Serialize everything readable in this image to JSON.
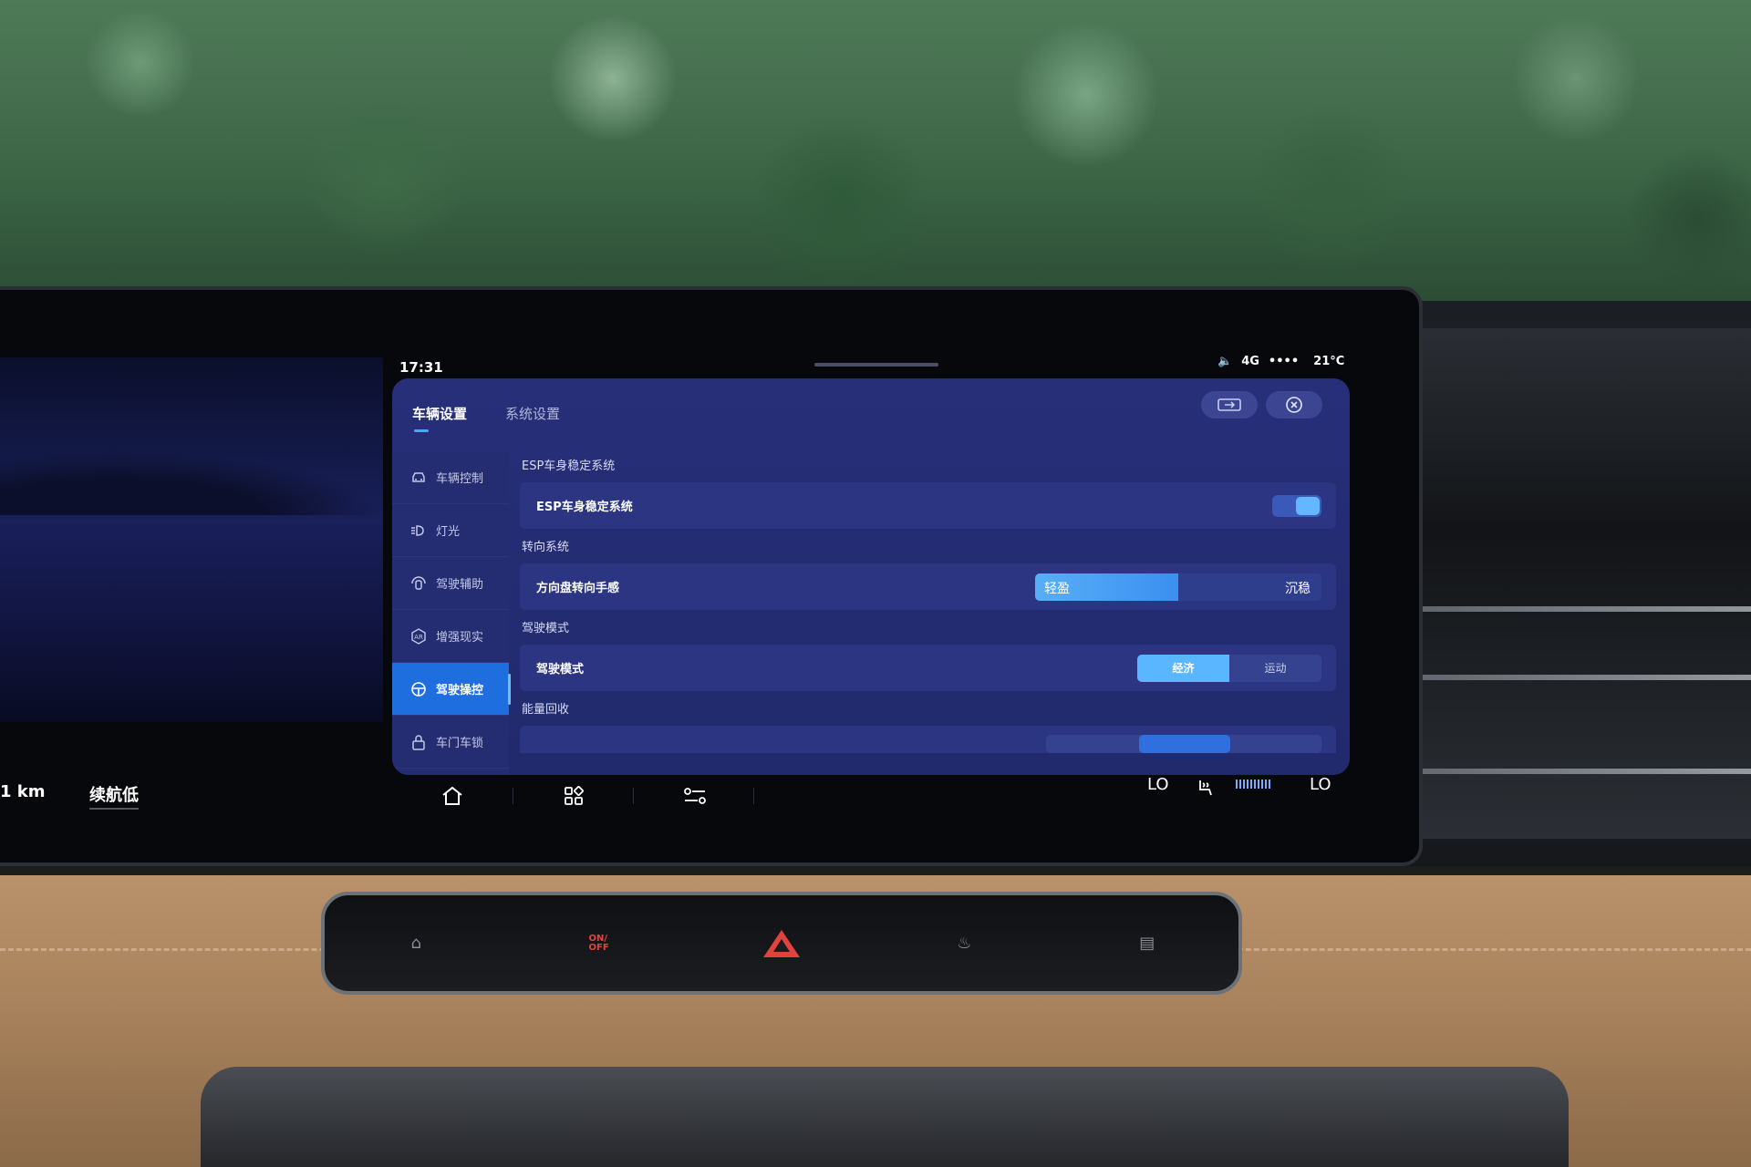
{
  "status_bar": {
    "time": "17:31",
    "network": "4G",
    "signal": "••••",
    "temperature": "21°C"
  },
  "tabs": [
    {
      "label": "车辆设置",
      "active": true
    },
    {
      "label": "系统设置",
      "active": false
    }
  ],
  "header_icons": {
    "left": "screen-switch-icon",
    "right": "close-icon"
  },
  "sidebar": {
    "items": [
      {
        "label": "车辆控制",
        "icon": "car-icon",
        "active": false
      },
      {
        "label": "灯光",
        "icon": "headlight-icon",
        "active": false
      },
      {
        "label": "驾驶辅助",
        "icon": "driving-assist-icon",
        "active": false
      },
      {
        "label": "增强现实",
        "icon": "ar-icon",
        "active": false
      },
      {
        "label": "驾驶操控",
        "icon": "steering-wheel-icon",
        "active": true
      },
      {
        "label": "车门车锁",
        "icon": "lock-icon",
        "active": false
      }
    ]
  },
  "sections": {
    "esp": {
      "title": "ESP车身稳定系统",
      "row_label": "ESP车身稳定系统",
      "toggle_on": true
    },
    "steering": {
      "title": "转向系统",
      "row_label": "方向盘转向手感",
      "left_option": "轻盈",
      "right_option": "沉稳",
      "selected_fraction": 0.5
    },
    "drive_mode": {
      "title": "驾驶模式",
      "row_label": "驾驶模式",
      "options": [
        "经济",
        "运动"
      ],
      "selected": "经济"
    },
    "energy": {
      "title": "能量回收"
    }
  },
  "dock": {
    "icons": [
      "home-icon",
      "apps-icon",
      "settings-list-icon"
    ]
  },
  "climate": {
    "left_temp": "LO",
    "right_temp": "LO",
    "fan_level": 10
  },
  "cluster": {
    "range_suffix": "1 km",
    "range_status": "续航低"
  },
  "hardware_buttons": {
    "engine_label": "ON/\nOFF"
  },
  "colors": {
    "accent": "#1f6ee0",
    "toggle": "#63b6ff",
    "panel_bg": "#262f78"
  }
}
